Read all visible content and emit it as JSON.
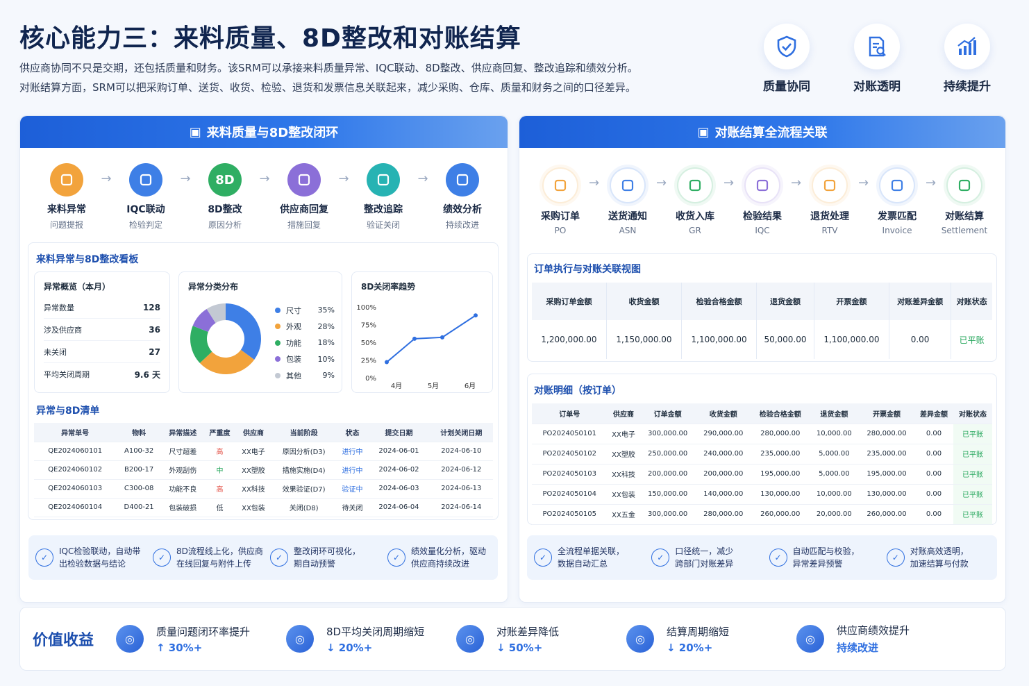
{
  "header": {
    "title": "核心能力三：来料质量、8D整改和对账结算",
    "line1": "供应商协同不只是交期，还包括质量和财务。该SRM可以承接来料质量异常、IQC联动、8D整改、供应商回复、整改追踪和绩效分析。",
    "line2": "对账结算方面，SRM可以把采购订单、送货、收货、检验、退货和发票信息关联起来，减少采购、仓库、质量和财务之间的口径差异。",
    "badges": [
      {
        "label": "质量协同",
        "icon": "shield-check-icon"
      },
      {
        "label": "对账透明",
        "icon": "document-search-icon"
      },
      {
        "label": "持续提升",
        "icon": "bar-chart-up-icon"
      }
    ]
  },
  "left": {
    "title": "来料质量与8D整改闭环",
    "steps": [
      {
        "name": "来料异常",
        "desc": "问题提报",
        "color": "#f2a33c",
        "icon": "box-icon"
      },
      {
        "name": "IQC联动",
        "desc": "检验判定",
        "color": "#3e7fe6",
        "icon": "shield-icon"
      },
      {
        "name": "8D整改",
        "desc": "原因分析",
        "color": "#2fae63",
        "icon": "8d-icon",
        "text": "8D"
      },
      {
        "name": "供应商回复",
        "desc": "措施回复",
        "color": "#8b6fd8",
        "icon": "chat-icon"
      },
      {
        "name": "整改追踪",
        "desc": "验证关闭",
        "color": "#27b3b3",
        "icon": "search-icon"
      },
      {
        "name": "绩效分析",
        "desc": "持续改进",
        "color": "#3e7fe6",
        "icon": "chart-icon"
      }
    ],
    "board_title": "来料异常与8D整改看板",
    "kpi": {
      "title": "异常概览（本月）",
      "rows": [
        {
          "k": "异常数量",
          "v": "128"
        },
        {
          "k": "涉及供应商",
          "v": "36"
        },
        {
          "k": "未关闭",
          "v": "27"
        },
        {
          "k": "平均关闭周期",
          "v": "9.6 天"
        }
      ]
    },
    "pie": {
      "title": "异常分类分布",
      "items": [
        {
          "name": "尺寸",
          "pct": "35%",
          "value": 35,
          "color": "#3e7fe6"
        },
        {
          "name": "外观",
          "pct": "28%",
          "value": 28,
          "color": "#f2a33c"
        },
        {
          "name": "功能",
          "pct": "18%",
          "value": 18,
          "color": "#2fae63"
        },
        {
          "name": "包装",
          "pct": "10%",
          "value": 10,
          "color": "#8b6fd8"
        },
        {
          "name": "其他",
          "pct": "9%",
          "value": 9,
          "color": "#c3c9d3"
        }
      ]
    },
    "trend": {
      "title": "8D关闭率趋势",
      "yticks": [
        "100%",
        "75%",
        "50%",
        "25%",
        "0%"
      ],
      "xticks": [
        "4月",
        "5月",
        "6月"
      ],
      "points": [
        22,
        55,
        57,
        88
      ]
    },
    "list_title": "异常与8D清单",
    "list_headers": [
      "异常单号",
      "物料",
      "异常描述",
      "严重度",
      "供应商",
      "当前阶段",
      "状态",
      "提交日期",
      "计划关闭日期"
    ],
    "list_rows": [
      [
        "QE2024060101",
        "A100-32",
        "尺寸超差",
        "高",
        "XX电子",
        "原因分析(D3)",
        "进行中",
        "2024-06-01",
        "2024-06-10"
      ],
      [
        "QE2024060102",
        "B200-17",
        "外观刮伤",
        "中",
        "XX塑胶",
        "措施实施(D4)",
        "进行中",
        "2024-06-02",
        "2024-06-12"
      ],
      [
        "QE2024060103",
        "C300-08",
        "功能不良",
        "高",
        "XX科技",
        "效果验证(D7)",
        "验证中",
        "2024-06-03",
        "2024-06-13"
      ],
      [
        "QE2024060104",
        "D400-21",
        "包装破损",
        "低",
        "XX包装",
        "关闭(D8)",
        "待关闭",
        "2024-06-04",
        "2024-06-14"
      ]
    ],
    "footer": [
      {
        "l1": "IQC检验联动，自动带",
        "l2": "出检验数据与结论",
        "icon": "check-circle-icon"
      },
      {
        "l1": "8D流程线上化，供应商",
        "l2": "在线回复与附件上传",
        "icon": "upload-icon"
      },
      {
        "l1": "整改闭环可视化，",
        "l2": "期自动预警",
        "icon": "cycle-icon"
      },
      {
        "l1": "绩效量化分析，驱动",
        "l2": "供应商持续改进",
        "icon": "trend-icon"
      }
    ]
  },
  "right": {
    "title": "对账结算全流程关联",
    "steps": [
      {
        "name": "采购订单",
        "desc": "PO",
        "color": "#f2a33c",
        "icon": "cart-icon"
      },
      {
        "name": "送货通知",
        "desc": "ASN",
        "color": "#3e7fe6",
        "icon": "truck-icon"
      },
      {
        "name": "收货入库",
        "desc": "GR",
        "color": "#2fae63",
        "icon": "cube-icon"
      },
      {
        "name": "检验结果",
        "desc": "IQC",
        "color": "#8b6fd8",
        "icon": "clipboard-icon"
      },
      {
        "name": "退货处理",
        "desc": "RTV",
        "color": "#f2a33c",
        "icon": "return-icon"
      },
      {
        "name": "发票匹配",
        "desc": "Invoice",
        "color": "#3e7fe6",
        "icon": "invoice-icon"
      },
      {
        "name": "对账结算",
        "desc": "Settlement",
        "color": "#2fae63",
        "icon": "yen-icon"
      }
    ],
    "view_title": "订单执行与对账关联视图",
    "sum_headers": [
      "采购订单金额",
      "收货金额",
      "检验合格金额",
      "退货金额",
      "开票金额",
      "对账差异金额",
      "对账状态"
    ],
    "sum_values": [
      "1,200,000.00",
      "1,150,000.00",
      "1,100,000.00",
      "50,000.00",
      "1,100,000.00",
      "0.00",
      "已平账"
    ],
    "detail_title": "对账明细（按订单）",
    "detail_headers": [
      "订单号",
      "供应商",
      "订单金额",
      "收货金额",
      "检验合格金额",
      "退货金额",
      "开票金额",
      "差异金额",
      "对账状态"
    ],
    "detail_rows": [
      [
        "PO2024050101",
        "XX电子",
        "300,000.00",
        "290,000.00",
        "280,000.00",
        "10,000.00",
        "280,000.00",
        "0.00",
        "已平账"
      ],
      [
        "PO2024050102",
        "XX塑胶",
        "250,000.00",
        "240,000.00",
        "235,000.00",
        "5,000.00",
        "235,000.00",
        "0.00",
        "已平账"
      ],
      [
        "PO2024050103",
        "XX科技",
        "200,000.00",
        "200,000.00",
        "195,000.00",
        "5,000.00",
        "195,000.00",
        "0.00",
        "已平账"
      ],
      [
        "PO2024050104",
        "XX包装",
        "150,000.00",
        "140,000.00",
        "130,000.00",
        "10,000.00",
        "130,000.00",
        "0.00",
        "已平账"
      ],
      [
        "PO2024050105",
        "XX五金",
        "300,000.00",
        "280,000.00",
        "260,000.00",
        "20,000.00",
        "260,000.00",
        "0.00",
        "已平账"
      ]
    ],
    "footer": [
      {
        "l1": "全流程单据关联，",
        "l2": "数据自动汇总",
        "icon": "docs-icon"
      },
      {
        "l1": "口径统一，减少",
        "l2": "跨部门对账差异",
        "icon": "edit-doc-icon"
      },
      {
        "l1": "自动匹配与校验，",
        "l2": "异常差异预警",
        "icon": "user-check-icon"
      },
      {
        "l1": "对账高效透明，",
        "l2": "加速结算与付款",
        "icon": "check-doc-icon"
      }
    ]
  },
  "value": {
    "title": "价值收益",
    "items": [
      {
        "name": "质量问题闭环率提升",
        "val": "↑ 30%+",
        "icon": "shield-check-icon"
      },
      {
        "name": "8D平均关闭周期缩短",
        "val": "↓ 20%+",
        "icon": "clock-icon"
      },
      {
        "name": "对账差异降低",
        "val": "↓ 50%+",
        "icon": "building-icon"
      },
      {
        "name": "结算周期缩短",
        "val": "↓ 20%+",
        "icon": "timer-icon"
      },
      {
        "name": "供应商绩效提升",
        "val": "持续改进",
        "icon": "growth-icon"
      }
    ]
  }
}
